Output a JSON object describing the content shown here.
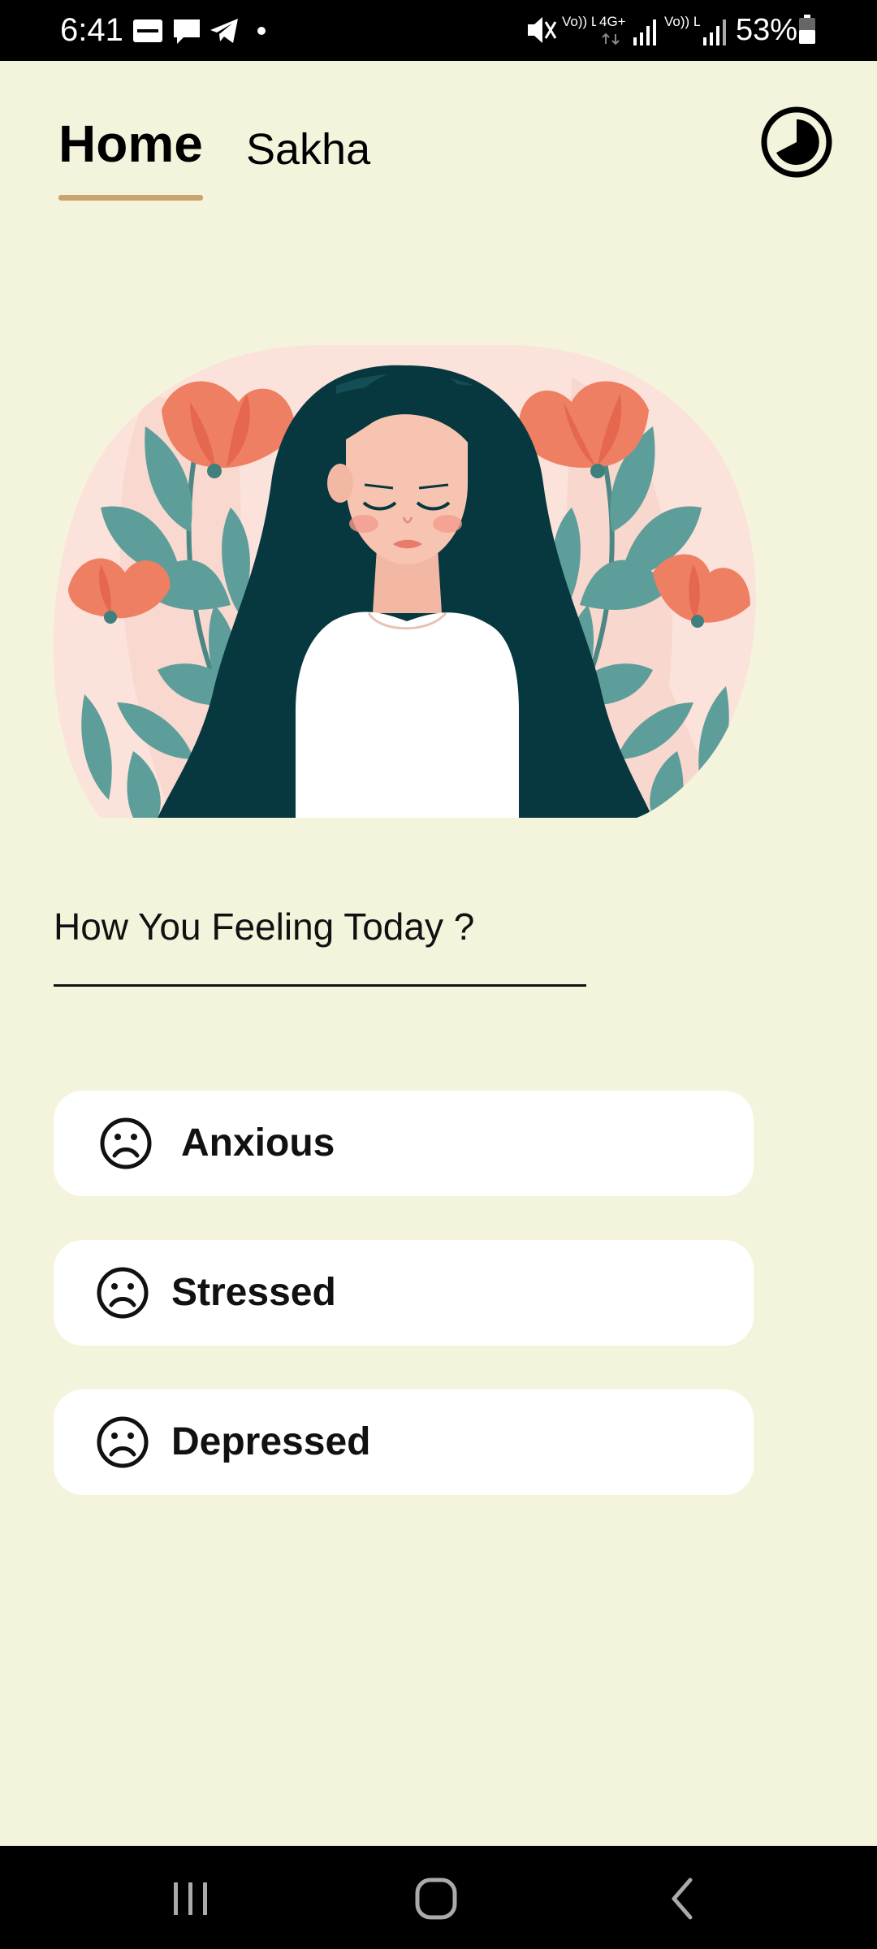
{
  "status_bar": {
    "time": "6:41",
    "battery": "53%",
    "network_1": "Vo)) LTE1",
    "network_type": "4G+",
    "network_2": "Vo)) LTE2",
    "notification_icons": [
      "zomato-icon",
      "message-icon",
      "telegram-icon",
      "dot-icon"
    ],
    "status_icons": [
      "mute-icon",
      "signal-icon",
      "signal-icon",
      "battery-icon"
    ]
  },
  "header": {
    "tabs": [
      {
        "label": "Home",
        "active": true
      },
      {
        "label": "Sakha",
        "active": false
      }
    ],
    "accent_color": "#caa46f",
    "theme_toggle_icon": "theme-toggle-icon"
  },
  "main": {
    "question": "How You Feeling Today ?",
    "moods": [
      {
        "label": "Anxious",
        "icon": "sad-face-icon"
      },
      {
        "label": "Stressed",
        "icon": "sad-face-icon"
      },
      {
        "label": "Depressed",
        "icon": "sad-face-icon"
      }
    ]
  },
  "colors": {
    "background": "#f4f4dc",
    "card": "#ffffff",
    "hair": "#08383f",
    "flower": "#ee7f62",
    "leaf": "#5e9e9a",
    "hero_bg": "#fbe2db"
  },
  "nav_bar": {
    "buttons": [
      "recents-icon",
      "home-icon",
      "back-icon"
    ]
  }
}
